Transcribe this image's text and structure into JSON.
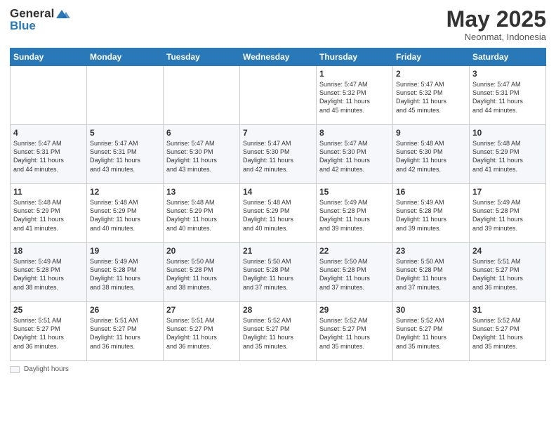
{
  "header": {
    "logo_line1": "General",
    "logo_line2": "Blue",
    "month_title": "May 2025",
    "location": "Neonmat, Indonesia"
  },
  "weekdays": [
    "Sunday",
    "Monday",
    "Tuesday",
    "Wednesday",
    "Thursday",
    "Friday",
    "Saturday"
  ],
  "footer": {
    "label": "Daylight hours"
  },
  "weeks": [
    [
      {
        "day": "",
        "info": ""
      },
      {
        "day": "",
        "info": ""
      },
      {
        "day": "",
        "info": ""
      },
      {
        "day": "",
        "info": ""
      },
      {
        "day": "1",
        "info": "Sunrise: 5:47 AM\nSunset: 5:32 PM\nDaylight: 11 hours\nand 45 minutes."
      },
      {
        "day": "2",
        "info": "Sunrise: 5:47 AM\nSunset: 5:32 PM\nDaylight: 11 hours\nand 45 minutes."
      },
      {
        "day": "3",
        "info": "Sunrise: 5:47 AM\nSunset: 5:31 PM\nDaylight: 11 hours\nand 44 minutes."
      }
    ],
    [
      {
        "day": "4",
        "info": "Sunrise: 5:47 AM\nSunset: 5:31 PM\nDaylight: 11 hours\nand 44 minutes."
      },
      {
        "day": "5",
        "info": "Sunrise: 5:47 AM\nSunset: 5:31 PM\nDaylight: 11 hours\nand 43 minutes."
      },
      {
        "day": "6",
        "info": "Sunrise: 5:47 AM\nSunset: 5:30 PM\nDaylight: 11 hours\nand 43 minutes."
      },
      {
        "day": "7",
        "info": "Sunrise: 5:47 AM\nSunset: 5:30 PM\nDaylight: 11 hours\nand 42 minutes."
      },
      {
        "day": "8",
        "info": "Sunrise: 5:47 AM\nSunset: 5:30 PM\nDaylight: 11 hours\nand 42 minutes."
      },
      {
        "day": "9",
        "info": "Sunrise: 5:48 AM\nSunset: 5:30 PM\nDaylight: 11 hours\nand 42 minutes."
      },
      {
        "day": "10",
        "info": "Sunrise: 5:48 AM\nSunset: 5:29 PM\nDaylight: 11 hours\nand 41 minutes."
      }
    ],
    [
      {
        "day": "11",
        "info": "Sunrise: 5:48 AM\nSunset: 5:29 PM\nDaylight: 11 hours\nand 41 minutes."
      },
      {
        "day": "12",
        "info": "Sunrise: 5:48 AM\nSunset: 5:29 PM\nDaylight: 11 hours\nand 40 minutes."
      },
      {
        "day": "13",
        "info": "Sunrise: 5:48 AM\nSunset: 5:29 PM\nDaylight: 11 hours\nand 40 minutes."
      },
      {
        "day": "14",
        "info": "Sunrise: 5:48 AM\nSunset: 5:29 PM\nDaylight: 11 hours\nand 40 minutes."
      },
      {
        "day": "15",
        "info": "Sunrise: 5:49 AM\nSunset: 5:28 PM\nDaylight: 11 hours\nand 39 minutes."
      },
      {
        "day": "16",
        "info": "Sunrise: 5:49 AM\nSunset: 5:28 PM\nDaylight: 11 hours\nand 39 minutes."
      },
      {
        "day": "17",
        "info": "Sunrise: 5:49 AM\nSunset: 5:28 PM\nDaylight: 11 hours\nand 39 minutes."
      }
    ],
    [
      {
        "day": "18",
        "info": "Sunrise: 5:49 AM\nSunset: 5:28 PM\nDaylight: 11 hours\nand 38 minutes."
      },
      {
        "day": "19",
        "info": "Sunrise: 5:49 AM\nSunset: 5:28 PM\nDaylight: 11 hours\nand 38 minutes."
      },
      {
        "day": "20",
        "info": "Sunrise: 5:50 AM\nSunset: 5:28 PM\nDaylight: 11 hours\nand 38 minutes."
      },
      {
        "day": "21",
        "info": "Sunrise: 5:50 AM\nSunset: 5:28 PM\nDaylight: 11 hours\nand 37 minutes."
      },
      {
        "day": "22",
        "info": "Sunrise: 5:50 AM\nSunset: 5:28 PM\nDaylight: 11 hours\nand 37 minutes."
      },
      {
        "day": "23",
        "info": "Sunrise: 5:50 AM\nSunset: 5:28 PM\nDaylight: 11 hours\nand 37 minutes."
      },
      {
        "day": "24",
        "info": "Sunrise: 5:51 AM\nSunset: 5:27 PM\nDaylight: 11 hours\nand 36 minutes."
      }
    ],
    [
      {
        "day": "25",
        "info": "Sunrise: 5:51 AM\nSunset: 5:27 PM\nDaylight: 11 hours\nand 36 minutes."
      },
      {
        "day": "26",
        "info": "Sunrise: 5:51 AM\nSunset: 5:27 PM\nDaylight: 11 hours\nand 36 minutes."
      },
      {
        "day": "27",
        "info": "Sunrise: 5:51 AM\nSunset: 5:27 PM\nDaylight: 11 hours\nand 36 minutes."
      },
      {
        "day": "28",
        "info": "Sunrise: 5:52 AM\nSunset: 5:27 PM\nDaylight: 11 hours\nand 35 minutes."
      },
      {
        "day": "29",
        "info": "Sunrise: 5:52 AM\nSunset: 5:27 PM\nDaylight: 11 hours\nand 35 minutes."
      },
      {
        "day": "30",
        "info": "Sunrise: 5:52 AM\nSunset: 5:27 PM\nDaylight: 11 hours\nand 35 minutes."
      },
      {
        "day": "31",
        "info": "Sunrise: 5:52 AM\nSunset: 5:27 PM\nDaylight: 11 hours\nand 35 minutes."
      }
    ]
  ]
}
